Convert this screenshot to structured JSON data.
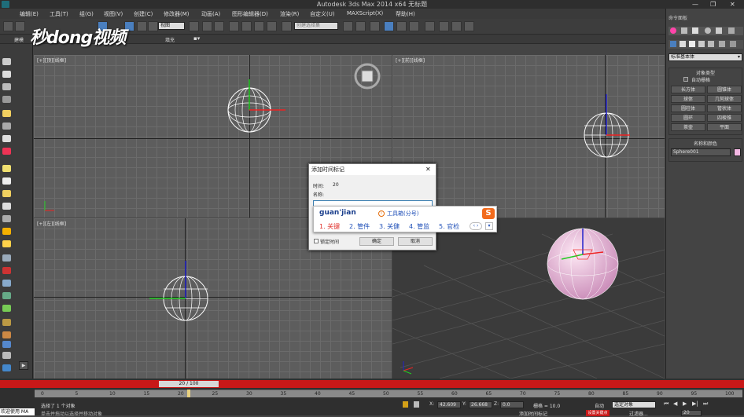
{
  "window": {
    "title": "Autodesk 3ds Max  2014 x64     无标题"
  },
  "menu": [
    "编辑(E)",
    "工具(T)",
    "组(G)",
    "视图(V)",
    "创建(C)",
    "修改器(M)",
    "动画(A)",
    "图形编辑器(D)",
    "渲染(R)",
    "自定义(U)",
    "MAXScript(X)",
    "帮助(H)"
  ],
  "toolbar": {
    "view_dropdown": "视图",
    "selection_set": "创建选择集"
  },
  "ribbon": {
    "item1": "建模",
    "item2": "填充"
  },
  "watermark": "秒dong视频",
  "viewports": {
    "top": "[+][顶][线框]",
    "right": "[+][前][线框]",
    "left": "[+][左][线框]",
    "persp": "[+][透视][真实]"
  },
  "command_panel": {
    "title": "命令面板",
    "category": "标准基本体",
    "object_type_header": "对象类型",
    "autogrid": "自动栅格",
    "buttons": [
      "长方体",
      "圆锥体",
      "球体",
      "几何球体",
      "圆柱体",
      "管状体",
      "圆环",
      "四棱锥",
      "茶壶",
      "平面"
    ],
    "name_color_header": "名称和颜色",
    "object_name": "Sphere001",
    "object_color": "#f4b8e4"
  },
  "dialog": {
    "title": "添加时间标记",
    "time_label": "时间:",
    "time_value": "20",
    "name_label": "名称:",
    "name_value": "",
    "lock_label": "锁定时间",
    "ok": "确定",
    "cancel": "取消"
  },
  "ime": {
    "composition": "guan'jian",
    "toolbox": "工具箱(分号)",
    "candidates": [
      "1. 关键",
      "2. 管件",
      "3. 关健",
      "4. 管监",
      "5. 官检"
    ]
  },
  "timeline": {
    "frame_counter": "20 / 100",
    "ticks": [
      "0",
      "5",
      "10",
      "15",
      "20",
      "25",
      "30",
      "35",
      "40",
      "45",
      "50",
      "55",
      "60",
      "65",
      "70",
      "75",
      "80",
      "85",
      "90",
      "95",
      "100"
    ]
  },
  "status": {
    "selection": "选择了 1 个对象",
    "prompt": "单击并拖动以选择并移动对象",
    "welcome": "欢迎使用 MA",
    "x_label": "X:",
    "x_value": "42.609",
    "y_label": "Y:",
    "y_value": "26.668",
    "z_label": "Z:",
    "z_value": "0.0",
    "grid": "栅格 = 10.0",
    "auto_key": "自动",
    "set_key": "设置关键点",
    "selected_dropdown": "选定对象",
    "key_filters": "过滤器...",
    "add_time_tag": "添加时间标记",
    "current_frame": "20"
  }
}
